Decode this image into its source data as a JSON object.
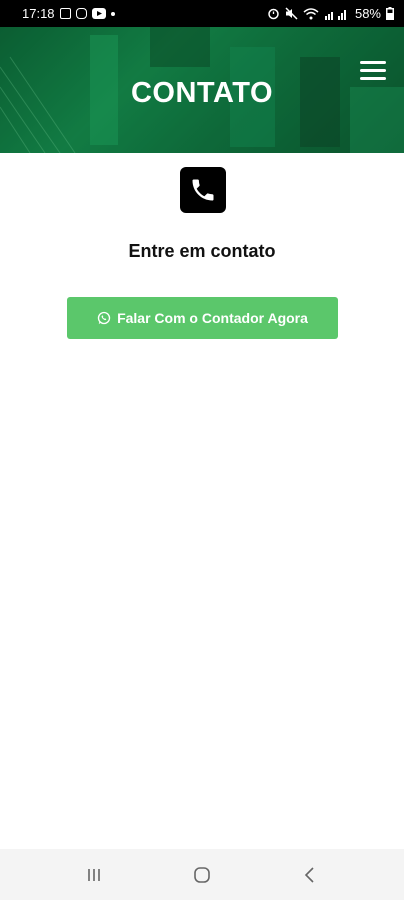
{
  "status_bar": {
    "time": "17:18",
    "battery": "58%",
    "left_icons": [
      "gallery-icon",
      "instagram-icon",
      "youtube-icon",
      "dot-icon"
    ],
    "right_icons": [
      "alarm-icon",
      "mute-icon",
      "wifi-icon",
      "signal-icon",
      "battery-icon"
    ]
  },
  "header": {
    "title": "CONTATO",
    "menu_icon": "hamburger-icon",
    "accent_color": "#14864a"
  },
  "main": {
    "phone_icon": "phone-icon",
    "heading": "Entre em contato",
    "cta": {
      "label": "Falar Com o Contador Agora",
      "icon": "whatsapp-icon",
      "color": "#5bc76b"
    }
  },
  "nav_bar": {
    "buttons": [
      "recent-apps-icon",
      "home-icon",
      "back-icon"
    ]
  }
}
